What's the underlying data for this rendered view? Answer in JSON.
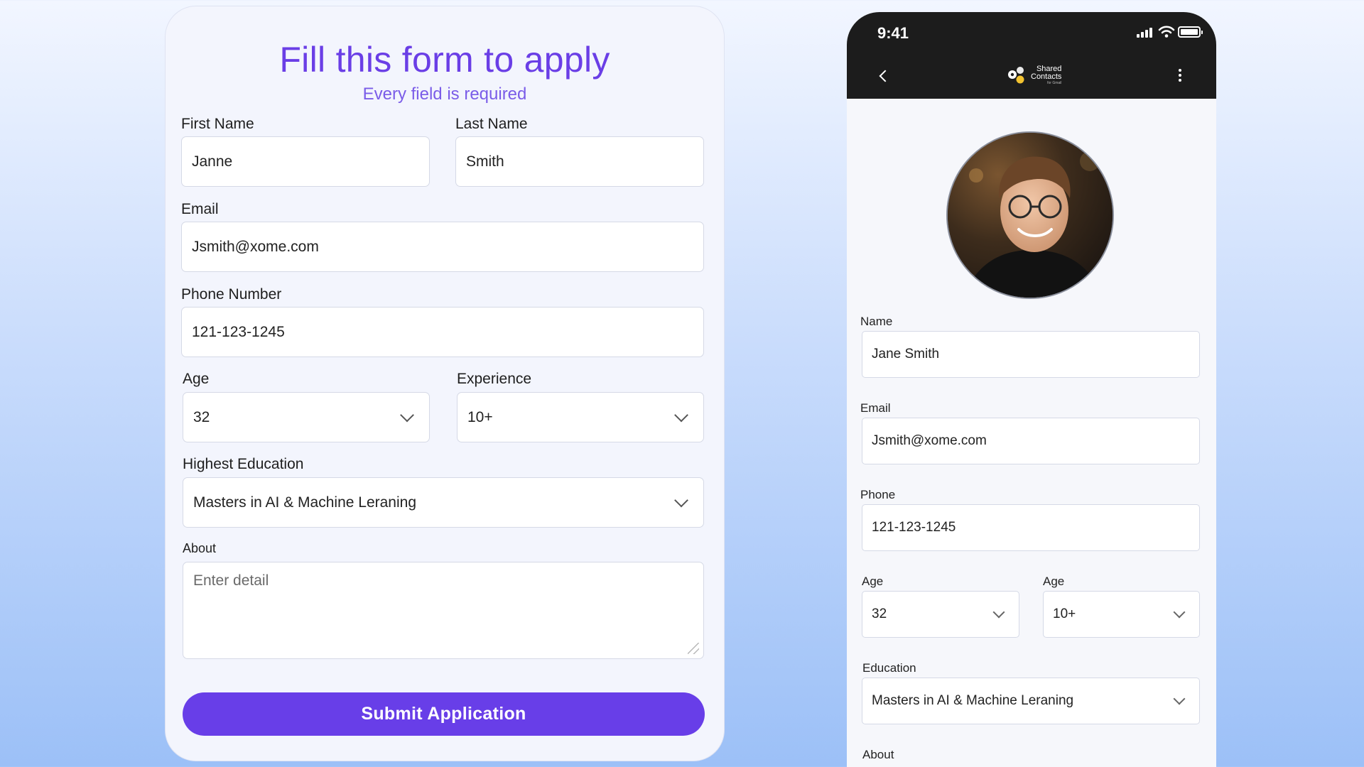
{
  "form": {
    "title": "Fill this form to apply",
    "subtitle": "Every field is required",
    "first_name": {
      "label": "First Name",
      "value": "Janne"
    },
    "last_name": {
      "label": "Last Name",
      "value": "Smith"
    },
    "email": {
      "label": "Email",
      "value": "Jsmith@xome.com"
    },
    "phone": {
      "label": "Phone Number",
      "value": "121-123-1245"
    },
    "age": {
      "label": "Age",
      "value": "32"
    },
    "experience": {
      "label": "Experience",
      "value": "10+"
    },
    "education": {
      "label": "Highest Education",
      "value": "Masters in AI & Machine Leraning"
    },
    "about": {
      "label": "About",
      "placeholder": "Enter detail"
    },
    "submit_label": "Submit Application"
  },
  "phone": {
    "status_time": "9:41",
    "app_name_line1": "Shared",
    "app_name_line2": "Contacts",
    "app_tagline": "for Gmail",
    "name": {
      "label": "Name",
      "value": "Jane Smith"
    },
    "email": {
      "label": "Email",
      "value": "Jsmith@xome.com"
    },
    "phone": {
      "label": "Phone",
      "value": "121-123-1245"
    },
    "age": {
      "label": "Age",
      "value": "32"
    },
    "age2": {
      "label": "Age",
      "value": "10+"
    },
    "education": {
      "label": "Education",
      "value": "Masters in AI & Machine Leraning"
    },
    "about": {
      "label": "About"
    }
  },
  "colors": {
    "accent": "#683ee8",
    "title": "#6a3ee6",
    "phone_header": "#1c1c1c"
  }
}
